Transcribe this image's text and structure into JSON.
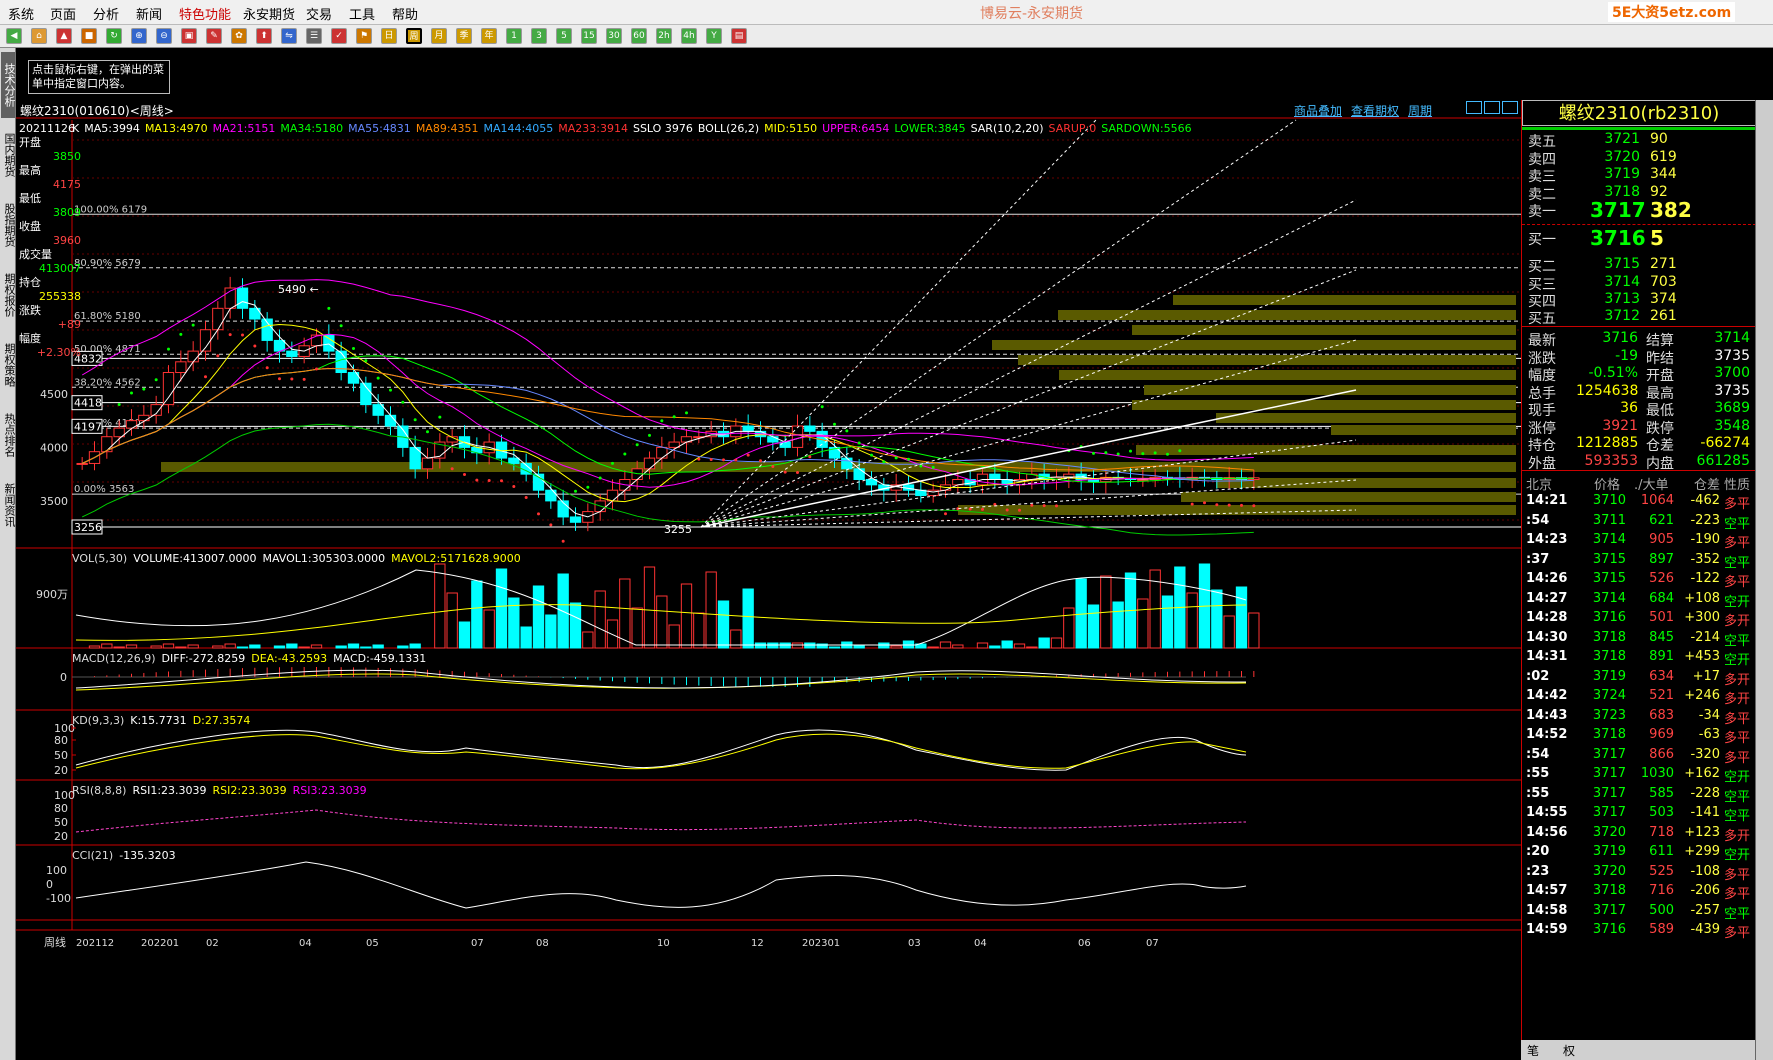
{
  "app": {
    "title": "博易云-永安期货",
    "watermark": "5E大资5etz.com",
    "menu": [
      "系统",
      "页面",
      "分析",
      "新闻",
      "特色功能",
      "永安期货",
      "交易",
      "工具",
      "帮助"
    ],
    "toolbar": [
      "◀",
      "⌂",
      "▲",
      "■",
      "↻",
      "⊕",
      "⊖",
      "▣",
      "✎",
      "✿",
      "⬆",
      "⇋",
      "☰",
      "✓",
      "⚑",
      "日",
      "周",
      "月",
      "季",
      "年",
      "1",
      "3",
      "5",
      "15",
      "30",
      "60",
      "2h",
      "4h",
      "Y",
      "▤"
    ],
    "left_tabs": [
      "技术分析",
      "国内期货",
      "股指期货",
      "期权报价",
      "期权策略",
      "热点排名",
      "新闻资讯"
    ],
    "hint": "点击鼠标右键，在弹出的菜单中指定窗口内容。"
  },
  "chart": {
    "title": "螺纹2310(010610)<周线>",
    "links": [
      "商品叠加",
      "查看期权",
      "周期"
    ],
    "main_indicators": [
      {
        "t": "K",
        "c": "#ffffff"
      },
      {
        "t": "MA5:3994",
        "c": "#ffffff"
      },
      {
        "t": "MA13:4970",
        "c": "#ffff00"
      },
      {
        "t": "MA21:5151",
        "c": "#ff00ff"
      },
      {
        "t": "MA34:5180",
        "c": "#00ff00"
      },
      {
        "t": "MA55:4831",
        "c": "#6688ff"
      },
      {
        "t": "MA89:4351",
        "c": "#ff8800"
      },
      {
        "t": "MA144:4055",
        "c": "#33aaff"
      },
      {
        "t": "MA233:3914",
        "c": "#ff3333"
      },
      {
        "t": "SSLO 3976",
        "c": "#ffffff"
      },
      {
        "t": "BOLL(26,2)",
        "c": "#ffffff"
      },
      {
        "t": "MID:5150",
        "c": "#ffff00"
      },
      {
        "t": "UPPER:6454",
        "c": "#ff00ff"
      },
      {
        "t": "LOWER:3845",
        "c": "#00ff00"
      },
      {
        "t": "SAR(10,2,20)",
        "c": "#ffffff"
      },
      {
        "t": "SARUP:0",
        "c": "#ff3333"
      },
      {
        "t": "SARDOWN:5566",
        "c": "#00ff00"
      }
    ],
    "ohlc": {
      "date": "20211126",
      "labels": [
        "开盘",
        "最高",
        "最低",
        "收盘",
        "成交量",
        "持仓",
        "涨跌",
        "幅度"
      ],
      "values": [
        "3850",
        "4175",
        "3809",
        "3960",
        "413007",
        "255338",
        "+89",
        "+2.30%"
      ],
      "colors": [
        "#00ff00",
        "#ff4444",
        "#00ff00",
        "#ff4444",
        "#00ff00",
        "#ffff00",
        "#ff4444",
        "#ff4444"
      ]
    },
    "price_labels": [
      "5490",
      "3255"
    ],
    "boxed_levels": [
      "4832",
      "4418",
      "4197",
      "3256"
    ],
    "y_ticks": [
      "4500",
      "4000",
      "3500"
    ],
    "fib_levels": [
      "100.00% 6179",
      "80.90% 5679",
      "61.80% 5180",
      "50.00% 4871",
      "38.20% 4562",
      "23.60% 4180",
      "0.00% 3563"
    ],
    "vol": {
      "label": "VOL(5,30)",
      "items": [
        {
          "t": "VOLUME:413007.0000",
          "c": "#ffffff"
        },
        {
          "t": "MAVOL1:305303.0000",
          "c": "#ffffff"
        },
        {
          "t": "MAVOL2:5171628.9000",
          "c": "#ffff00"
        }
      ],
      "y": "900万"
    },
    "macd": {
      "label": "MACD(12,26,9)",
      "items": [
        {
          "t": "DIFF:-272.8259",
          "c": "#ffffff"
        },
        {
          "t": "DEA:-43.2593",
          "c": "#ffff00"
        },
        {
          "t": "MACD:-459.1331",
          "c": "#ffffff"
        }
      ],
      "y": "0"
    },
    "kd": {
      "label": "KD(9,3,3)",
      "items": [
        {
          "t": "K:15.7731",
          "c": "#ffffff"
        },
        {
          "t": "D:27.3574",
          "c": "#ffff00"
        }
      ],
      "y": [
        "100",
        "80",
        "50",
        "20"
      ]
    },
    "rsi": {
      "label": "RSI(8,8,8)",
      "items": [
        {
          "t": "RSI1:23.3039",
          "c": "#ffffff"
        },
        {
          "t": "RSI2:23.3039",
          "c": "#ffff00"
        },
        {
          "t": "RSI3:23.3039",
          "c": "#ff00ff"
        }
      ],
      "y": [
        "100",
        "80",
        "50",
        "20"
      ]
    },
    "cci": {
      "label": "CCI(21)",
      "items": [
        {
          "t": "-135.3203",
          "c": "#ffffff"
        }
      ],
      "y": [
        "100",
        "0",
        "-100"
      ]
    },
    "x_axis": {
      "period": "周线",
      "labels": [
        "202112",
        "202201",
        "02",
        "04",
        "05",
        "07",
        "08",
        "10",
        "12",
        "202301",
        "03",
        "04",
        "06",
        "07"
      ]
    }
  },
  "quote": {
    "title": "螺纹2310(rb2310)",
    "asks": [
      {
        "l": "卖五",
        "p": "3721",
        "v": "90"
      },
      {
        "l": "卖四",
        "p": "3720",
        "v": "619"
      },
      {
        "l": "卖三",
        "p": "3719",
        "v": "344"
      },
      {
        "l": "卖二",
        "p": "3718",
        "v": "92"
      },
      {
        "l": "卖一",
        "p": "3717",
        "v": "382"
      }
    ],
    "bids": [
      {
        "l": "买一",
        "p": "3716",
        "v": "5"
      },
      {
        "l": "买二",
        "p": "3715",
        "v": "271"
      },
      {
        "l": "买三",
        "p": "3714",
        "v": "703"
      },
      {
        "l": "买四",
        "p": "3713",
        "v": "374"
      },
      {
        "l": "买五",
        "p": "3712",
        "v": "261"
      }
    ],
    "stats": [
      {
        "l1": "最新",
        "v1": "3716",
        "c1": "#00ff00",
        "l2": "结算",
        "v2": "3714",
        "c2": "#00ff00"
      },
      {
        "l1": "涨跌",
        "v1": "-19",
        "c1": "#00ff00",
        "l2": "昨结",
        "v2": "3735",
        "c2": "#ffffff"
      },
      {
        "l1": "幅度",
        "v1": "-0.51%",
        "c1": "#00ff00",
        "l2": "开盘",
        "v2": "3700",
        "c2": "#00ff00"
      },
      {
        "l1": "总手",
        "v1": "1254638",
        "c1": "#ffff00",
        "l2": "最高",
        "v2": "3735",
        "c2": "#ffffff"
      },
      {
        "l1": "现手",
        "v1": "36",
        "c1": "#ffff00",
        "l2": "最低",
        "v2": "3689",
        "c2": "#00ff00"
      },
      {
        "l1": "涨停",
        "v1": "3921",
        "c1": "#ff4444",
        "l2": "跌停",
        "v2": "3548",
        "c2": "#00ff00"
      },
      {
        "l1": "持仓",
        "v1": "1212885",
        "c1": "#ffff00",
        "l2": "仓差",
        "v2": "-66274",
        "c2": "#ffff00"
      },
      {
        "l1": "外盘",
        "v1": "593353",
        "c1": "#ff4444",
        "l2": "内盘",
        "v2": "661285",
        "c2": "#00ff00"
      }
    ],
    "tick_header": [
      "北京",
      "价格",
      "./大单",
      "仓差",
      "性质"
    ],
    "ticks": [
      [
        "14:21",
        "3710",
        "1064",
        "-462",
        "多平"
      ],
      [
        ":54",
        "3711",
        "621",
        "-223",
        "空平"
      ],
      [
        "14:23",
        "3714",
        "905",
        "-190",
        "多平"
      ],
      [
        ":37",
        "3715",
        "897",
        "-352",
        "空平"
      ],
      [
        "14:26",
        "3715",
        "526",
        "-122",
        "多平"
      ],
      [
        "14:27",
        "3714",
        "684",
        "+108",
        "空开"
      ],
      [
        "14:28",
        "3716",
        "501",
        "+300",
        "多开"
      ],
      [
        "14:30",
        "3718",
        "845",
        "-214",
        "空平"
      ],
      [
        "14:31",
        "3718",
        "891",
        "+453",
        "空开"
      ],
      [
        ":02",
        "3719",
        "634",
        "+17",
        "多开"
      ],
      [
        "14:42",
        "3724",
        "521",
        "+246",
        "多开"
      ],
      [
        "14:43",
        "3723",
        "683",
        "-34",
        "多平"
      ],
      [
        "14:52",
        "3718",
        "969",
        "-63",
        "多平"
      ],
      [
        ":54",
        "3717",
        "866",
        "-320",
        "多平"
      ],
      [
        ":55",
        "3717",
        "1030",
        "+162",
        "空开"
      ],
      [
        ":55",
        "3717",
        "585",
        "-228",
        "空平"
      ],
      [
        "14:55",
        "3717",
        "503",
        "-141",
        "空平"
      ],
      [
        "14:56",
        "3720",
        "718",
        "+123",
        "多开"
      ],
      [
        ":20",
        "3719",
        "611",
        "+299",
        "空开"
      ],
      [
        ":23",
        "3720",
        "525",
        "-108",
        "多平"
      ],
      [
        "14:57",
        "3718",
        "716",
        "-206",
        "多平"
      ],
      [
        "14:58",
        "3717",
        "500",
        "-257",
        "空平"
      ],
      [
        "14:59",
        "3716",
        "589",
        "-439",
        "多平"
      ]
    ],
    "bottom_tabs": [
      "笔",
      "权"
    ]
  },
  "colors": {
    "up": "#ff3333",
    "down": "#00ffff",
    "ma5": "#ffffff",
    "ma13": "#ffff00",
    "ma21": "#ff00ff",
    "ma34": "#00ff00",
    "ma55": "#6688ff",
    "ma89": "#ff8800",
    "grid": "#660000"
  }
}
